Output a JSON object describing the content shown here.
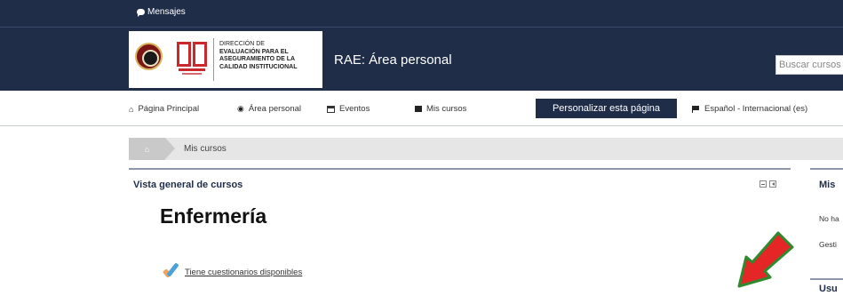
{
  "topbar": {
    "messages_label": "Mensajes"
  },
  "header": {
    "logo_lines": [
      "Dirección de",
      "evaluación para el",
      "aseguramiento de la",
      "calidad institucional"
    ],
    "site_title": "RAE: Área personal",
    "search_placeholder": "Buscar cursos"
  },
  "nav": {
    "items": [
      {
        "label": "Página Principal",
        "icon": "home-icon"
      },
      {
        "label": "Área personal",
        "icon": "tachometer-icon"
      },
      {
        "label": "Eventos",
        "icon": "calendar-icon"
      },
      {
        "label": "Mis cursos",
        "icon": "briefcase-icon"
      }
    ],
    "personalize_label": "Personalizar esta página",
    "language_label": "Español - Internacional (es)"
  },
  "breadcrumb": {
    "current": "Mis cursos"
  },
  "course_overview": {
    "block_title": "Vista general de cursos",
    "course_name": "Enfermería",
    "quiz_link": "Tiene cuestionarios disponibles"
  },
  "sidebar": {
    "block1_title": "Mis",
    "block1_text1": "No ha",
    "block1_text2": "Gesti",
    "block2_title": "Usu"
  },
  "colors": {
    "header_bg": "#1f2d48",
    "accent_red": "#e52626",
    "arrow_green": "#2f8a2f"
  }
}
